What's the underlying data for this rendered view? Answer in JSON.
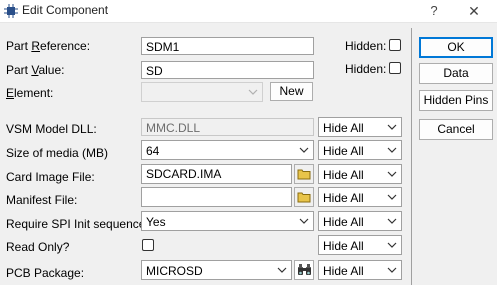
{
  "window": {
    "title": "Edit Component",
    "help": "?",
    "close": "✕"
  },
  "fields": {
    "part_reference": {
      "label_pre": "Part ",
      "label_u": "R",
      "label_post": "eference:",
      "value": "SDM1",
      "hidden_label": "Hidden:",
      "hidden": false
    },
    "part_value": {
      "label_pre": "Part ",
      "label_u": "V",
      "label_post": "alue:",
      "value": "SD",
      "hidden_label": "Hidden:",
      "hidden": false
    },
    "element": {
      "label_u": "E",
      "label_post": "lement:",
      "value": "",
      "new_label": "New"
    }
  },
  "properties": [
    {
      "label": "VSM Model DLL:",
      "value": "MMC.DLL",
      "kind": "text-disabled",
      "visibility": "Hide All"
    },
    {
      "label": "Size of media (MB)",
      "value": "64",
      "kind": "combo",
      "visibility": "Hide All"
    },
    {
      "label": "Card Image File:",
      "value": "SDCARD.IMA",
      "kind": "file",
      "visibility": "Hide All"
    },
    {
      "label": "Manifest File:",
      "value": "",
      "kind": "file",
      "visibility": "Hide All"
    },
    {
      "label": "Require SPI Init sequence:",
      "value": "Yes",
      "kind": "combo",
      "visibility": "Hide All"
    },
    {
      "label": "Read Only?",
      "value": false,
      "kind": "checkbox",
      "visibility": "Hide All"
    },
    {
      "label": "PCB Package:",
      "value": "MICROSD",
      "kind": "package",
      "visibility": "Hide All"
    }
  ],
  "buttons": {
    "ok": "OK",
    "data": "Data",
    "hidden_pins": "Hidden Pins",
    "cancel": "Cancel"
  },
  "colors": {
    "accent": "#0078d7",
    "folder": "#e8c44a"
  }
}
